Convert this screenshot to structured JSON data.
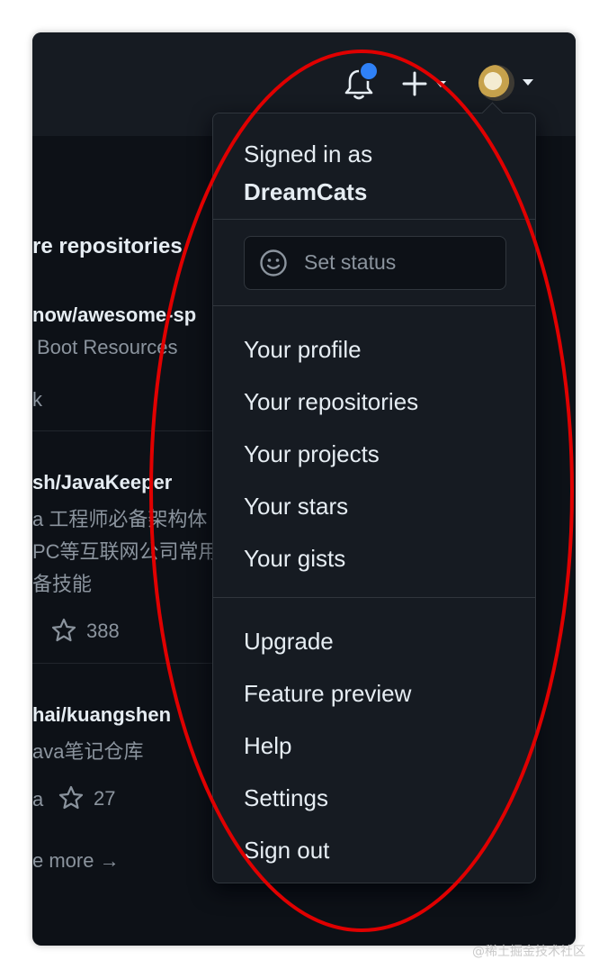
{
  "header": {
    "notifications_icon": "bell-icon",
    "create_icon": "plus-icon",
    "avatar_icon": "user-avatar"
  },
  "left_panel": {
    "heading": "re repositories",
    "repos": [
      {
        "name": "now/awesome-sp",
        "description": "Boot Resources",
        "meta": "k",
        "stars": ""
      },
      {
        "name": "sh/JavaKeeper",
        "description_lines": [
          "a 工程师必备架构体",
          "PC等互联网公司常用",
          "备技能"
        ],
        "stars": "388"
      },
      {
        "name": "hai/kuangshen",
        "description": "ava笔记仓库",
        "meta": "a",
        "stars": "27"
      }
    ],
    "see_more": "e more →"
  },
  "dropdown": {
    "signed_in_as": "Signed in as",
    "username": "DreamCats",
    "set_status": "Set status",
    "profile_items": [
      "Your profile",
      "Your repositories",
      "Your projects",
      "Your stars",
      "Your gists"
    ],
    "other_items": [
      "Upgrade",
      "Feature preview",
      "Help",
      "Settings",
      "Sign out"
    ]
  },
  "colors": {
    "background": "#0d1117",
    "header": "#161b22",
    "dropdown_bg": "#161b22",
    "border": "#30363d",
    "text": "#e6edf3",
    "muted": "#8b949e",
    "notification_dot": "#2f81f7",
    "annotation_ellipse": "#e00000"
  },
  "watermark": "@稀土掘金技术社区"
}
